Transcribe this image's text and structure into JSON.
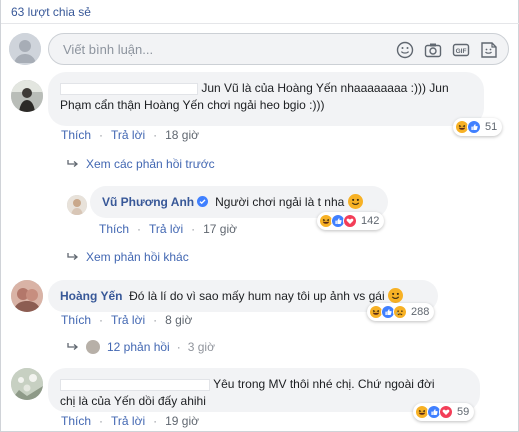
{
  "header": {
    "shares": "63 lượt chia sẻ"
  },
  "composer": {
    "placeholder": "Viết bình luận..."
  },
  "comments": [
    {
      "text_line1": "Jun Vũ là của Hoàng Yến nhaaaaaaaa :))) Jun",
      "text_line2": "Phạm cẩn thận Hoàng Yến chơi ngải heo bgio :)))",
      "like": "Thích",
      "reply": "Trả lời",
      "time": "18 giờ",
      "reaction_count": "51"
    },
    {
      "view_previous": "Xem các phản hồi trước"
    },
    {
      "name": "Vũ Phương Anh",
      "text": "Người chơi ngải là t nha",
      "like": "Thích",
      "reply": "Trả lời",
      "time": "17 giờ",
      "reaction_count": "142"
    },
    {
      "view_more": "Xem phản hồi khác"
    },
    {
      "name": "Hoàng Yến",
      "text": "Đó là lí do vì sao mấy hum nay tôi up ảnh vs gái",
      "like": "Thích",
      "reply": "Trả lời",
      "time": "8 giờ",
      "reaction_count": "288",
      "replies_label": "12 phản hồi",
      "replies_time": "3 giờ"
    },
    {
      "text_line1": "Yêu trong MV thôi nhé chị. Chứ ngoài đời",
      "text_line2": "chị là của Yến dồi đấy ahihi",
      "like": "Thích",
      "reply": "Trả lời",
      "time": "19 giờ",
      "reaction_count": "59"
    }
  ],
  "dot": "·",
  "colors": {
    "link": "#385898",
    "bubble": "#f2f3f5",
    "like_blue": "#4080ff",
    "love_red": "#f33e58",
    "haha_yellow": "#f7b125"
  },
  "icons": [
    "emoji-icon",
    "camera-icon",
    "gif-icon",
    "sticker-icon",
    "reply-arrow-icon",
    "verified-badge-icon",
    "haha-reaction-icon",
    "like-reaction-icon",
    "love-reaction-icon",
    "sad-reaction-icon"
  ]
}
